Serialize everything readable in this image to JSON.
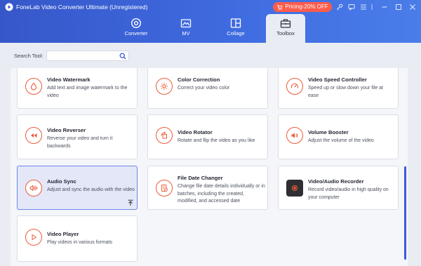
{
  "app": {
    "title": "FoneLab Video Converter Ultimate (Unregistered)",
    "pricing_label": "Pricing-20% OFF"
  },
  "tabs": [
    {
      "label": "Converter",
      "icon": "converter-icon",
      "active": false
    },
    {
      "label": "MV",
      "icon": "mv-icon",
      "active": false
    },
    {
      "label": "Collage",
      "icon": "collage-icon",
      "active": false
    },
    {
      "label": "Toolbox",
      "icon": "toolbox-icon",
      "active": true
    }
  ],
  "search": {
    "label": "Search Tool:",
    "value": "",
    "placeholder": ""
  },
  "tools": [
    {
      "title": "Video Watermark",
      "desc": "Add text and image watermark to the video",
      "icon": "watermark-icon"
    },
    {
      "title": "Color Correction",
      "desc": "Correct your video color",
      "icon": "color-correction-icon"
    },
    {
      "title": "Video Speed Controller",
      "desc": "Speed up or slow down your file at ease",
      "icon": "speed-icon"
    },
    {
      "title": "Video Reverser",
      "desc": "Reverse your video and turn it backwards",
      "icon": "rewind-icon"
    },
    {
      "title": "Video Rotator",
      "desc": "Rotate and flip the video as you like",
      "icon": "rotate-icon"
    },
    {
      "title": "Volume Booster",
      "desc": "Adjust the volume of the video",
      "icon": "volume-icon"
    },
    {
      "title": "Audio Sync",
      "desc": "Adjust and sync the audio with the video",
      "icon": "audio-sync-icon",
      "selected": true
    },
    {
      "title": "File Date Changer",
      "desc": "Change file date details individually or in batches, including the created, modified, and accessed date",
      "icon": "file-date-icon"
    },
    {
      "title": "Video/Audio Recorder",
      "desc": "Record video/audio in high quality on your computer",
      "icon": "recorder-icon"
    },
    {
      "title": "Video Player",
      "desc": "Play videos in various formats",
      "icon": "play-icon"
    }
  ],
  "colors": {
    "accent": "#3b5bd9",
    "tool_icon": "#ec5b38",
    "pricing_bg": "#ff5b4a"
  }
}
